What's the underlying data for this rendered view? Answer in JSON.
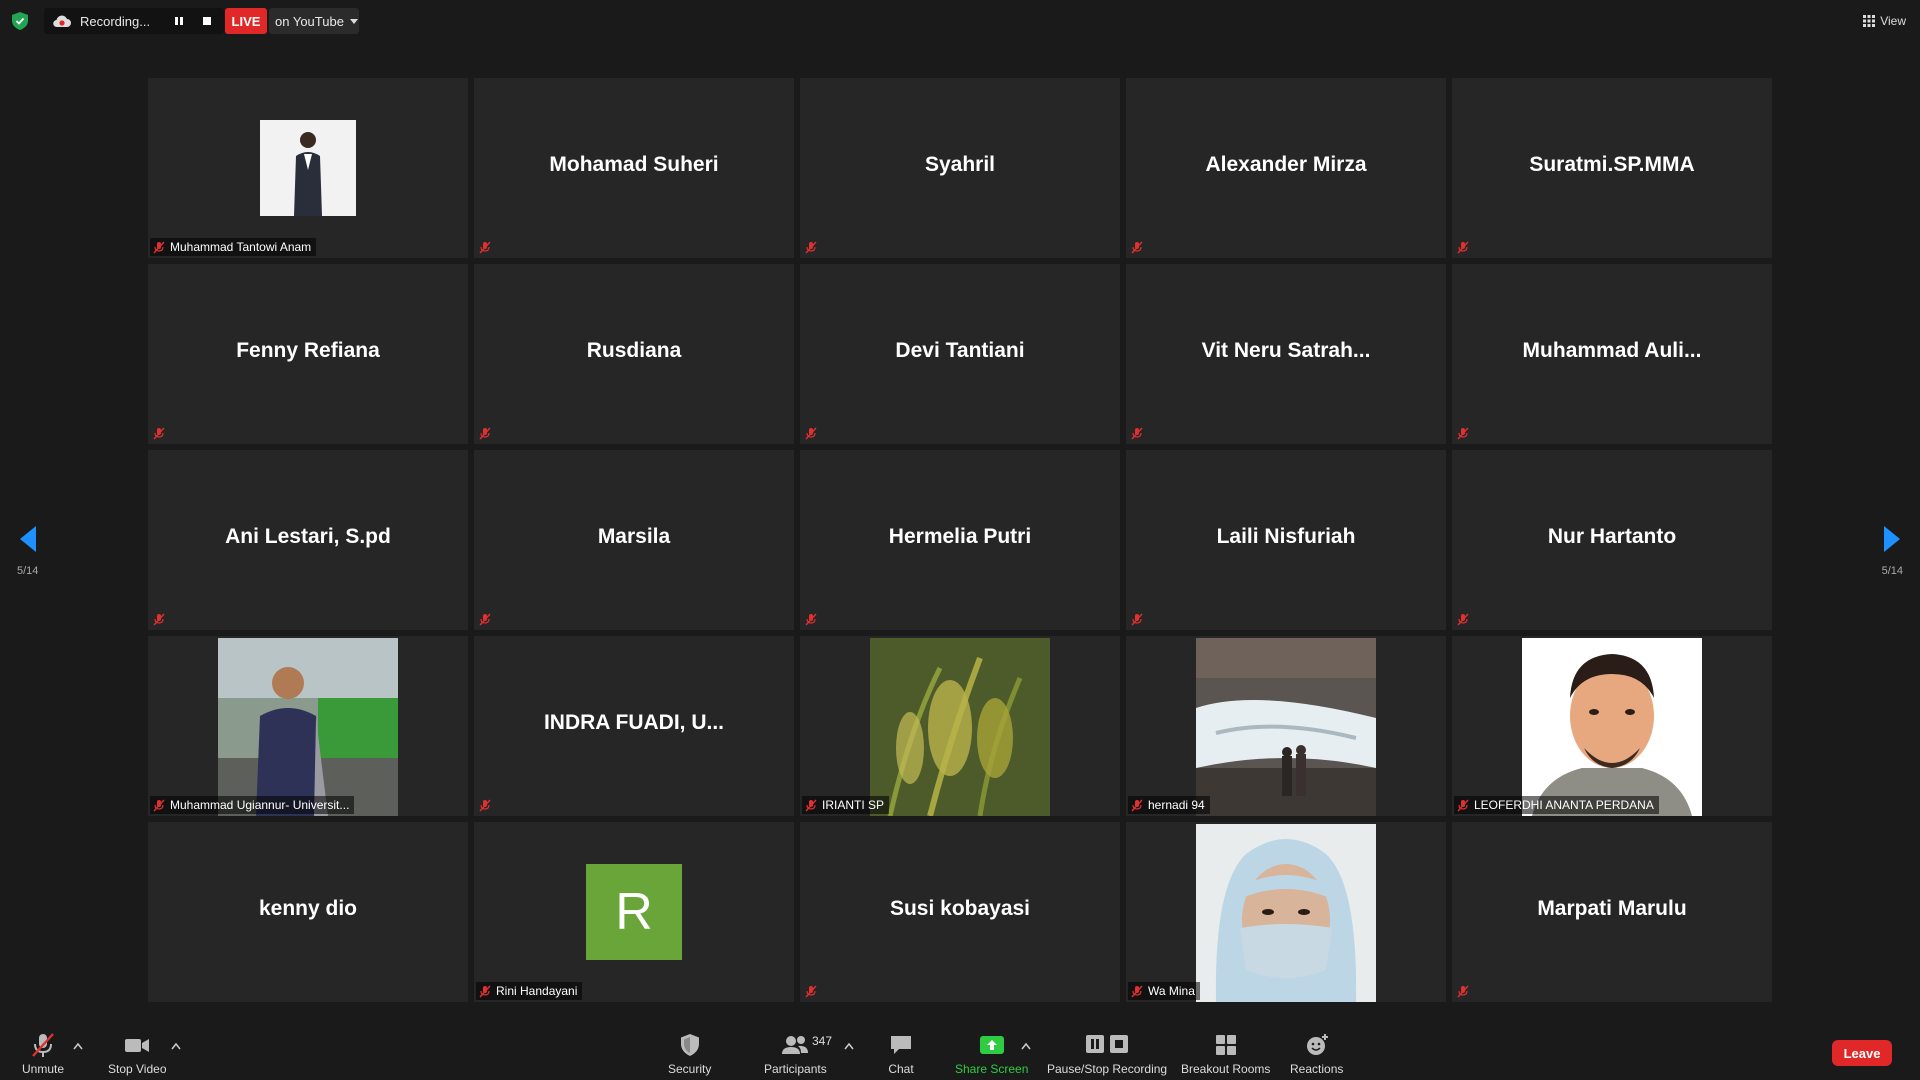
{
  "topbar": {
    "recording_label": "Recording...",
    "live_label": "LIVE",
    "stream_target": "on YouTube",
    "view_label": "View"
  },
  "pager": {
    "page": "5/14"
  },
  "tiles": [
    {
      "type": "photo",
      "photo": "man-in-suit",
      "label": "Muhammad Tantowi Anam"
    },
    {
      "type": "name",
      "name": "Mohamad Suheri"
    },
    {
      "type": "name",
      "name": "Syahril"
    },
    {
      "type": "name",
      "name": "Alexander Mirza"
    },
    {
      "type": "name",
      "name": "Suratmi.SP.MMA"
    },
    {
      "type": "name",
      "name": "Fenny Refiana"
    },
    {
      "type": "name",
      "name": "Rusdiana"
    },
    {
      "type": "name",
      "name": "Devi Tantiani"
    },
    {
      "type": "name",
      "name": "Vit Neru Satrah..."
    },
    {
      "type": "name",
      "name": "Muhammad  Auli..."
    },
    {
      "type": "name",
      "name": "Ani Lestari, S.pd"
    },
    {
      "type": "name",
      "name": "Marsila"
    },
    {
      "type": "name",
      "name": "Hermelia Putri"
    },
    {
      "type": "name",
      "name": "Laili Nisfuriah"
    },
    {
      "type": "name",
      "name": "Nur Hartanto"
    },
    {
      "type": "photo",
      "photo": "man-outdoor",
      "label": "Muhammad Ugiannur- Universit..."
    },
    {
      "type": "name",
      "name": "INDRA  FUADI,  U..."
    },
    {
      "type": "photo",
      "photo": "rice-plant",
      "label": "IRIANTI SP"
    },
    {
      "type": "photo",
      "photo": "waterfall",
      "label": "hernadi 94"
    },
    {
      "type": "photo",
      "photo": "cartoon-man",
      "label": "LEOFERDHI ANANTA PERDANA"
    },
    {
      "type": "name",
      "name": "kenny dio"
    },
    {
      "type": "letter",
      "letter": "R",
      "label": "Rini Handayani"
    },
    {
      "type": "name",
      "name": "Susi kobayasi"
    },
    {
      "type": "photo",
      "photo": "masked-woman",
      "label": "Wa Mina"
    },
    {
      "type": "name",
      "name": "Marpati Marulu"
    }
  ],
  "toolbar": {
    "unmute": "Unmute",
    "stop_video": "Stop Video",
    "security": "Security",
    "participants": "Participants",
    "participants_count": "347",
    "chat": "Chat",
    "share_screen": "Share Screen",
    "pause_stop_recording": "Pause/Stop Recording",
    "breakout_rooms": "Breakout Rooms",
    "reactions": "Reactions",
    "leave": "Leave"
  },
  "colors": {
    "background": "#1a1a1a",
    "tile": "#262626",
    "live_red": "#e02828",
    "share_green": "#2ecc40",
    "arrow_blue": "#1e90ff",
    "muted_red": "#e03030",
    "avatar_green": "#6aa53a"
  }
}
